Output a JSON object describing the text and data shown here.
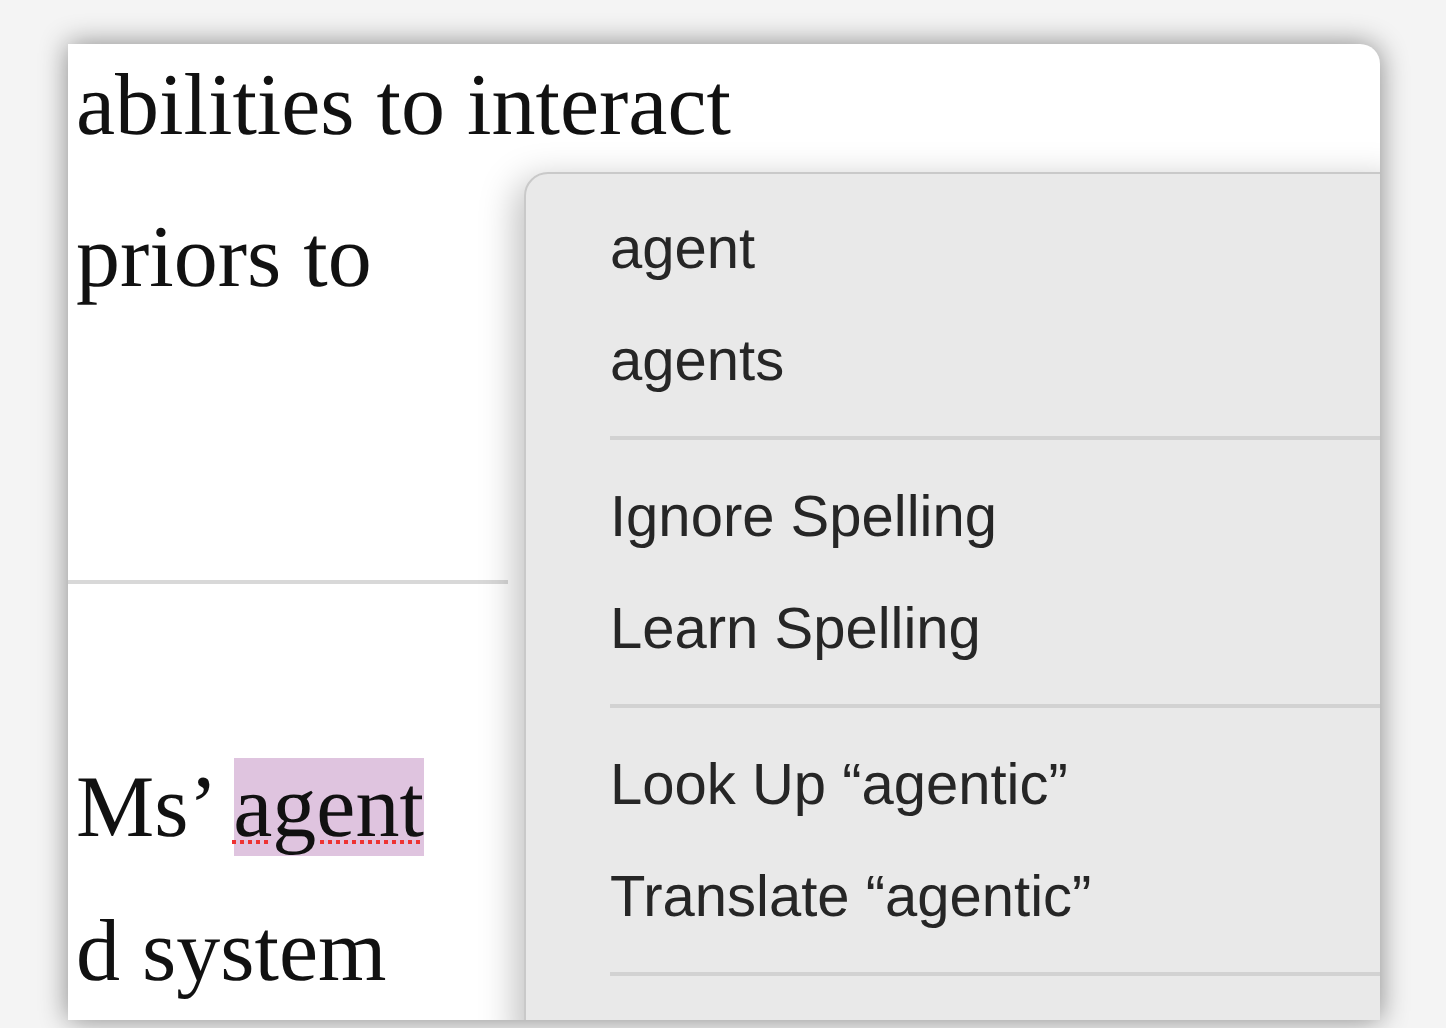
{
  "document": {
    "paragraph_1": [
      "abilities to interact",
      "priors to"
    ],
    "paragraph_2": [
      {
        "prefix": "Ms’ ",
        "misspelled_word": "agent"
      },
      {
        "prefix": "d system"
      }
    ]
  },
  "context_menu": {
    "groups": [
      [
        "agent",
        "agents"
      ],
      [
        "Ignore Spelling",
        "Learn Spelling"
      ],
      [
        "Look Up “agentic”",
        "Translate “agentic”"
      ]
    ]
  }
}
